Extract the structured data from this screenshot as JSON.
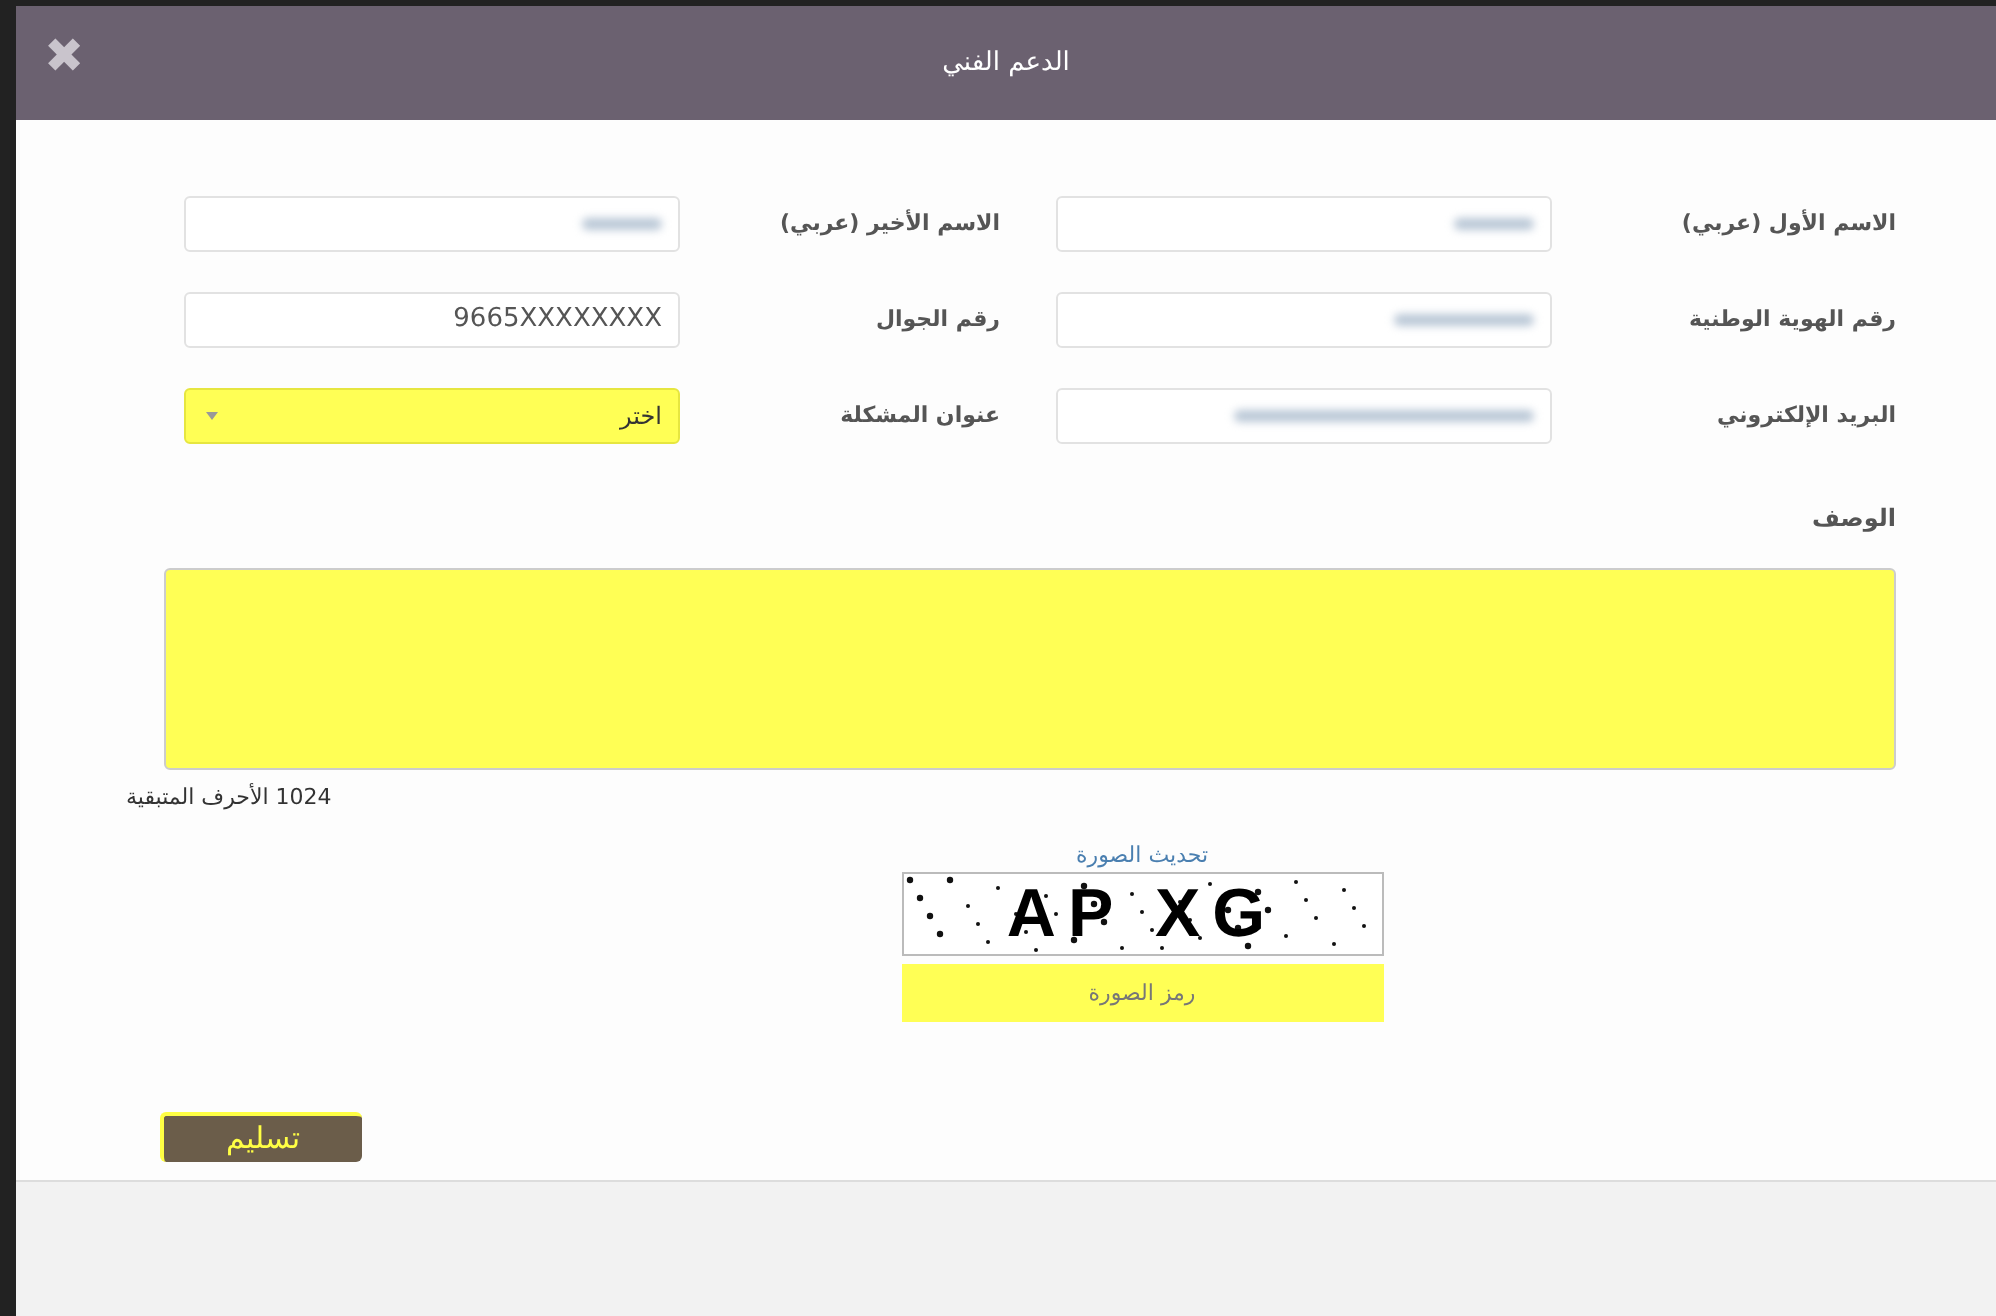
{
  "window": {
    "title": "الدعم الفني",
    "close_icon": "✖"
  },
  "fields": [
    {
      "label": "الاسم الأول (عربي)",
      "kind": "text",
      "blurred": true,
      "highlighted": false
    },
    {
      "label": "الاسم الأخير (عربي)",
      "kind": "text",
      "blurred": true,
      "highlighted": false
    },
    {
      "label": "رقم الهوية الوطنية",
      "kind": "text",
      "blurred": true,
      "highlighted": false
    },
    {
      "label": "رقم الجوال",
      "kind": "text",
      "value": "9665XXXXXXXX",
      "highlighted": false
    },
    {
      "label": "البريد الإلكتروني",
      "kind": "text",
      "blurred": true,
      "highlighted": false
    },
    {
      "label": "عنوان المشكلة",
      "kind": "select",
      "value": "اختر",
      "highlighted": true
    }
  ],
  "description": {
    "label": "الوصف",
    "highlighted": true,
    "counter": "1024 الأحرف المتبقية"
  },
  "captcha": {
    "refresh_link": "تحديث الصورة",
    "code": "AP XG",
    "input_placeholder": "رمز الصورة",
    "highlighted": true
  },
  "submit_button": "تسليم"
}
